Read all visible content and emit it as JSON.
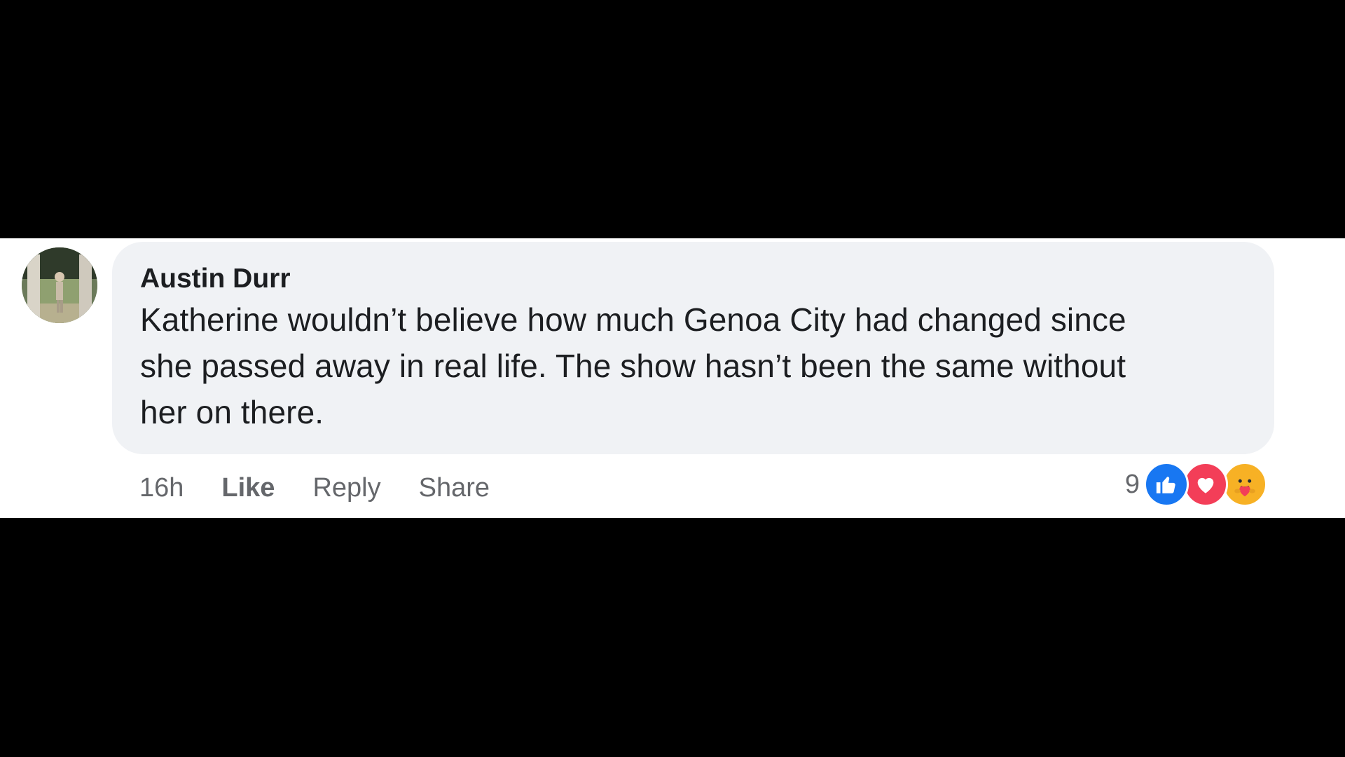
{
  "comment": {
    "author": "Austin Durr",
    "lines": [
      "Katherine wouldn’t believe how much Genoa City had changed since",
      "she passed away in real life. The show hasn’t been the same without",
      "her on there."
    ],
    "time": "16h",
    "actions": {
      "like": "Like",
      "reply": "Reply",
      "share": "Share"
    },
    "reactions": {
      "count": "9",
      "types": [
        "like-icon",
        "love-icon",
        "care-icon"
      ],
      "colors": {
        "like": "#1877f2",
        "love": "#f33e58",
        "care": "#f7b125"
      }
    }
  }
}
